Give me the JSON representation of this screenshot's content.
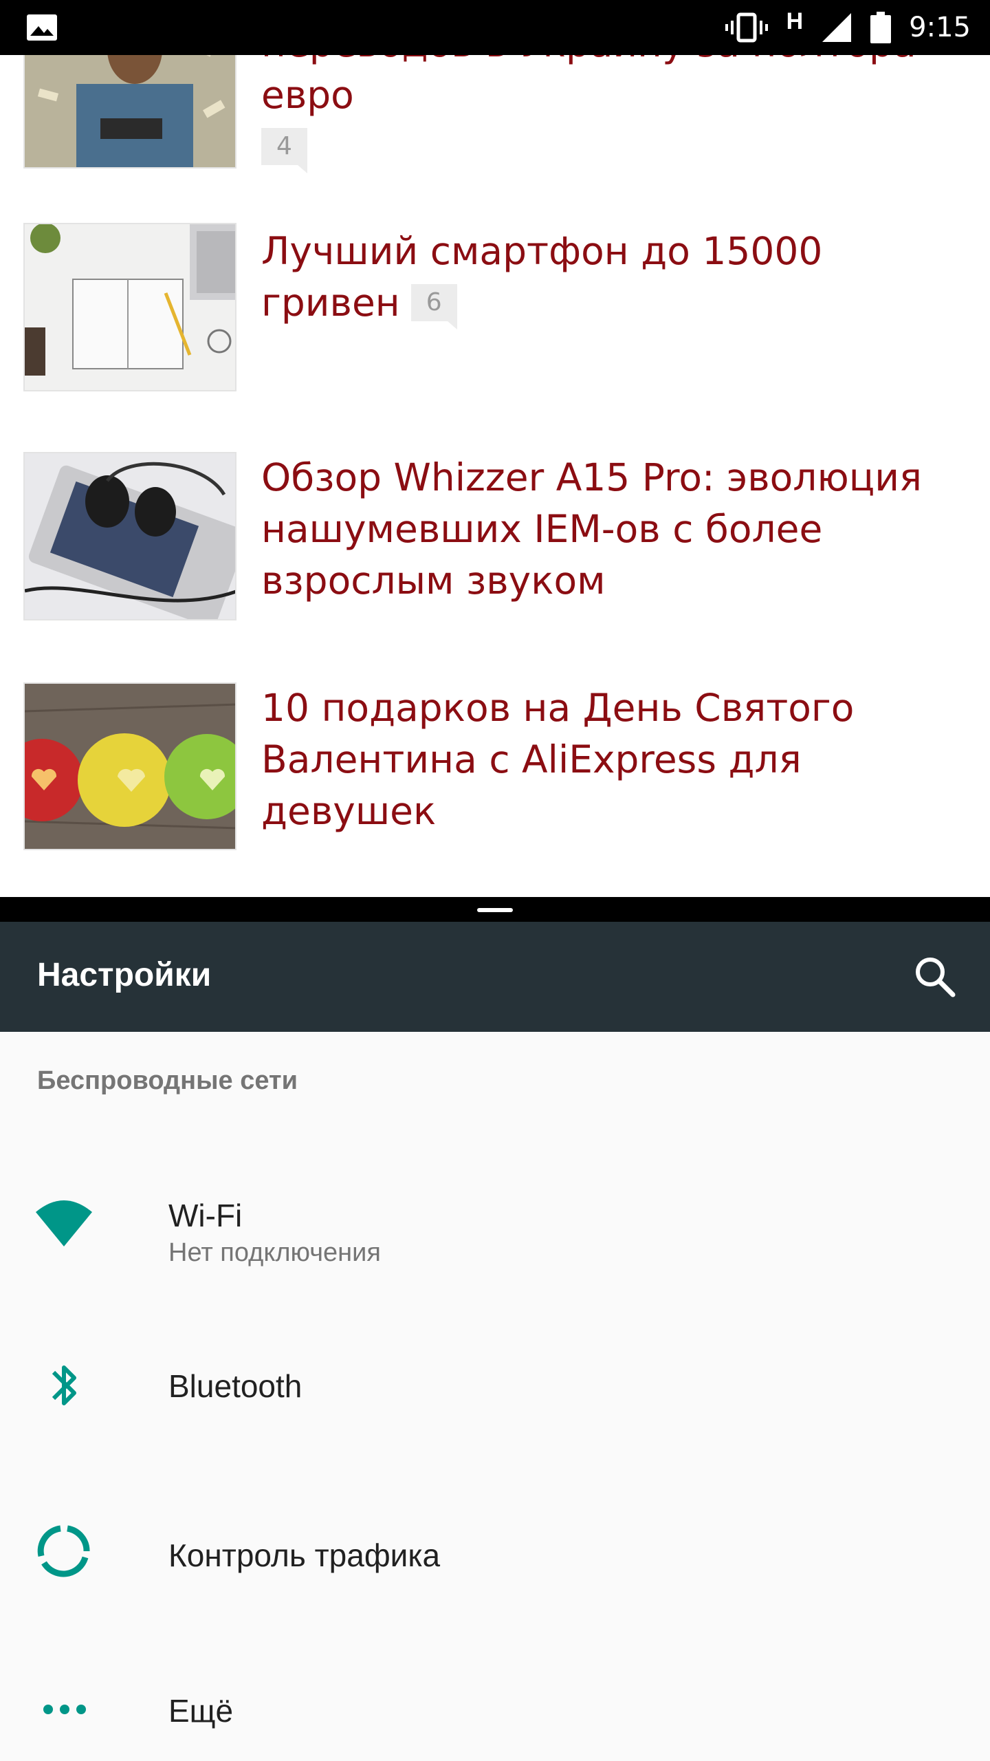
{
  "status_bar": {
    "time": "9:15",
    "network": "H"
  },
  "articles": [
    {
      "title": "переводов в Украину за полтора евро",
      "comments": "4"
    },
    {
      "title": "Лучший смартфон до 15000 гривен",
      "comments": "6"
    },
    {
      "title": "Обзор Whizzer A15 Pro: эволюция нашумевших IEM-ов с более взрослым звуком"
    },
    {
      "title": "10 подарков на День Святого Валентина с AliExpress для девушек"
    }
  ],
  "settings": {
    "title": "Настройки",
    "section": "Беспроводные сети",
    "items": [
      {
        "title": "Wi-Fi",
        "subtitle": "Нет подключения",
        "icon": "wifi-icon"
      },
      {
        "title": "Bluetooth",
        "icon": "bluetooth-icon"
      },
      {
        "title": "Контроль трафика",
        "icon": "data-usage-icon"
      },
      {
        "title": "Ещё",
        "icon": "more-icon"
      }
    ],
    "accent": "#009688",
    "toolbar_color": "#263238"
  },
  "colors": {
    "headline": "#8b0d12"
  }
}
